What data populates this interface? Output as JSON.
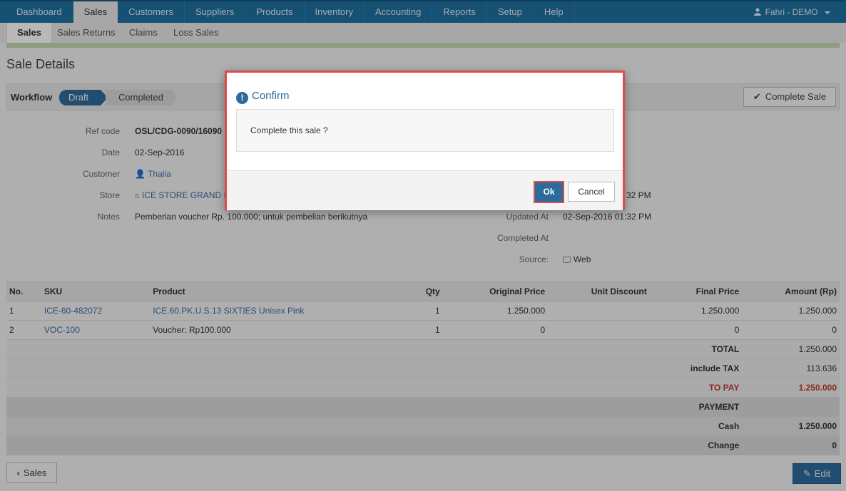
{
  "nav": {
    "items": [
      "Dashboard",
      "Sales",
      "Customers",
      "Suppliers",
      "Products",
      "Inventory",
      "Accounting",
      "Reports",
      "Setup",
      "Help"
    ],
    "active": "Sales",
    "user": "Fahri - DEMO"
  },
  "subnav": {
    "items": [
      "Sales",
      "Sales Returns",
      "Claims",
      "Loss Sales"
    ]
  },
  "page": {
    "title": "Sale Details"
  },
  "workflow": {
    "label": "Workflow",
    "draft": "Draft",
    "completed": "Completed",
    "complete_button": "Complete Sale"
  },
  "details": {
    "ref_label": "Ref code",
    "ref_value": "OSL/CDG-0090/16090",
    "date_label": "Date",
    "date_value": "02-Sep-2016",
    "customer_label": "Customer",
    "customer_value": "Thalia",
    "store_label": "Store",
    "store_value": "ICE STORE GRAND IN",
    "notes_label": "Notes",
    "notes_value": "Pemberian voucher Rp. 100.000; untuk pembelian berikutnya",
    "created_partial": "32 PM",
    "updated_label": "Updated At",
    "updated_value": "02-Sep-2016 01:32 PM",
    "completed_label": "Completed At",
    "source_label": "Source:",
    "source_value": "Web"
  },
  "table": {
    "headers": [
      "No.",
      "SKU",
      "Product",
      "Qty",
      "Original Price",
      "Unit Discount",
      "Final Price",
      "Amount (Rp)"
    ],
    "rows": [
      {
        "no": "1",
        "sku": "ICE-60-482072",
        "product": "ICE.60.PK.U.S.13 SIXTIES Unisex Pink",
        "qty": "1",
        "original": "1.250.000",
        "discount": "",
        "final": "1.250.000",
        "amount": "1.250.000"
      },
      {
        "no": "2",
        "sku": "VOC-100",
        "product": "Voucher: Rp100.000",
        "qty": "1",
        "original": "0",
        "discount": "",
        "final": "0",
        "amount": "0"
      }
    ],
    "summary": {
      "total_label": "TOTAL",
      "total_value": "1.250.000",
      "tax_label": "include TAX",
      "tax_value": "113.636",
      "topay_label": "TO PAY",
      "topay_value": "1.250.000",
      "payment_label": "PAYMENT",
      "cash_label": "Cash",
      "cash_value": "1.250.000",
      "change_label": "Change",
      "change_value": "0"
    }
  },
  "footer": {
    "back_label": "Sales",
    "edit_label": "Edit"
  },
  "modal": {
    "title": "Confirm",
    "message": "Complete this sale ?",
    "ok": "Ok",
    "cancel": "Cancel"
  },
  "colors": {
    "nav": "#1f6fa0",
    "primary": "#2e6b9c",
    "highlight": "#e24a4a",
    "topay": "#c0392b"
  }
}
